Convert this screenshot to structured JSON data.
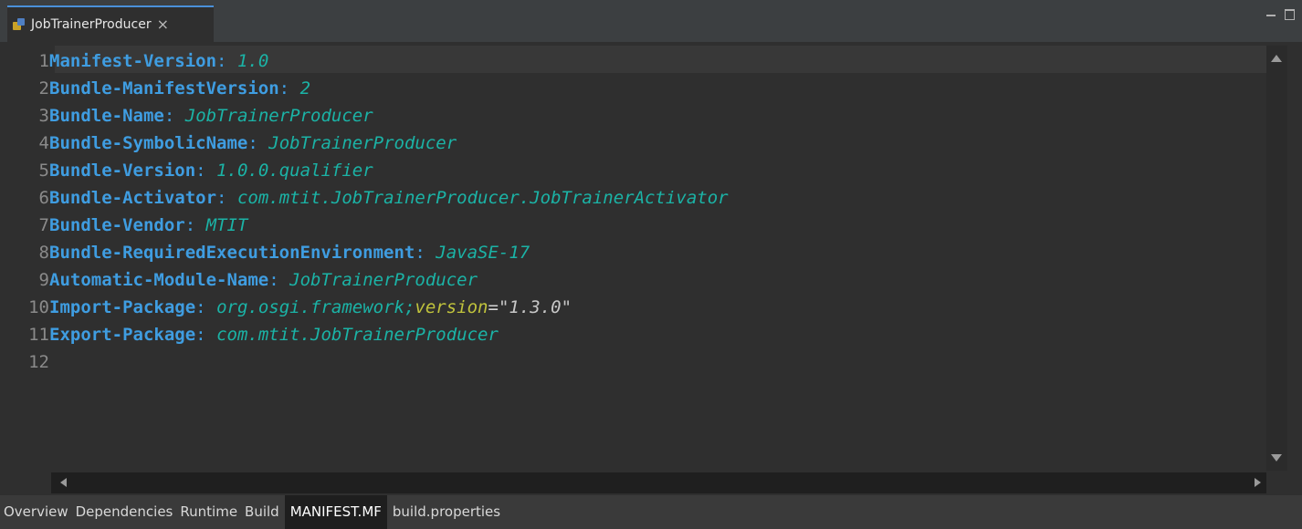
{
  "editor_tab": {
    "title": "JobTrainerProducer",
    "close_glyph": "×",
    "icon": "manifest-file-icon"
  },
  "manifest_lines": [
    {
      "n": "1",
      "key": "Manifest-Version",
      "colon": ":",
      "value": "1.0"
    },
    {
      "n": "2",
      "key": "Bundle-ManifestVersion",
      "colon": ":",
      "value": "2"
    },
    {
      "n": "3",
      "key": "Bundle-Name",
      "colon": ":",
      "value": "JobTrainerProducer"
    },
    {
      "n": "4",
      "key": "Bundle-SymbolicName",
      "colon": ":",
      "value": "JobTrainerProducer"
    },
    {
      "n": "5",
      "key": "Bundle-Version",
      "colon": ":",
      "value": "1.0.0.qualifier"
    },
    {
      "n": "6",
      "key": "Bundle-Activator",
      "colon": ":",
      "value": "com.mtit.JobTrainerProducer.JobTrainerActivator"
    },
    {
      "n": "7",
      "key": "Bundle-Vendor",
      "colon": ":",
      "value": "MTIT"
    },
    {
      "n": "8",
      "key": "Bundle-RequiredExecutionEnvironment",
      "colon": ":",
      "value": "JavaSE-17"
    },
    {
      "n": "9",
      "key": "Automatic-Module-Name",
      "colon": ":",
      "value": "JobTrainerProducer"
    },
    {
      "n": "10",
      "key": "Import-Package",
      "colon": ":",
      "value": "org.osgi.framework;",
      "attr": "version",
      "eq": "=",
      "str": "\"1.3.0\""
    },
    {
      "n": "11",
      "key": "Export-Package",
      "colon": ":",
      "value": "com.mtit.JobTrainerProducer"
    },
    {
      "n": "12",
      "key": "",
      "colon": "",
      "value": ""
    }
  ],
  "bottom_tabs": [
    {
      "label": "Overview"
    },
    {
      "label": "Dependencies"
    },
    {
      "label": "Runtime"
    },
    {
      "label": "Build"
    },
    {
      "label": "MANIFEST.MF",
      "active": true
    },
    {
      "label": "build.properties"
    }
  ],
  "colors": {
    "key": "#3f9de1",
    "value": "#1bb3a6",
    "attr": "#c0c33c",
    "background": "#2f2f2f"
  }
}
